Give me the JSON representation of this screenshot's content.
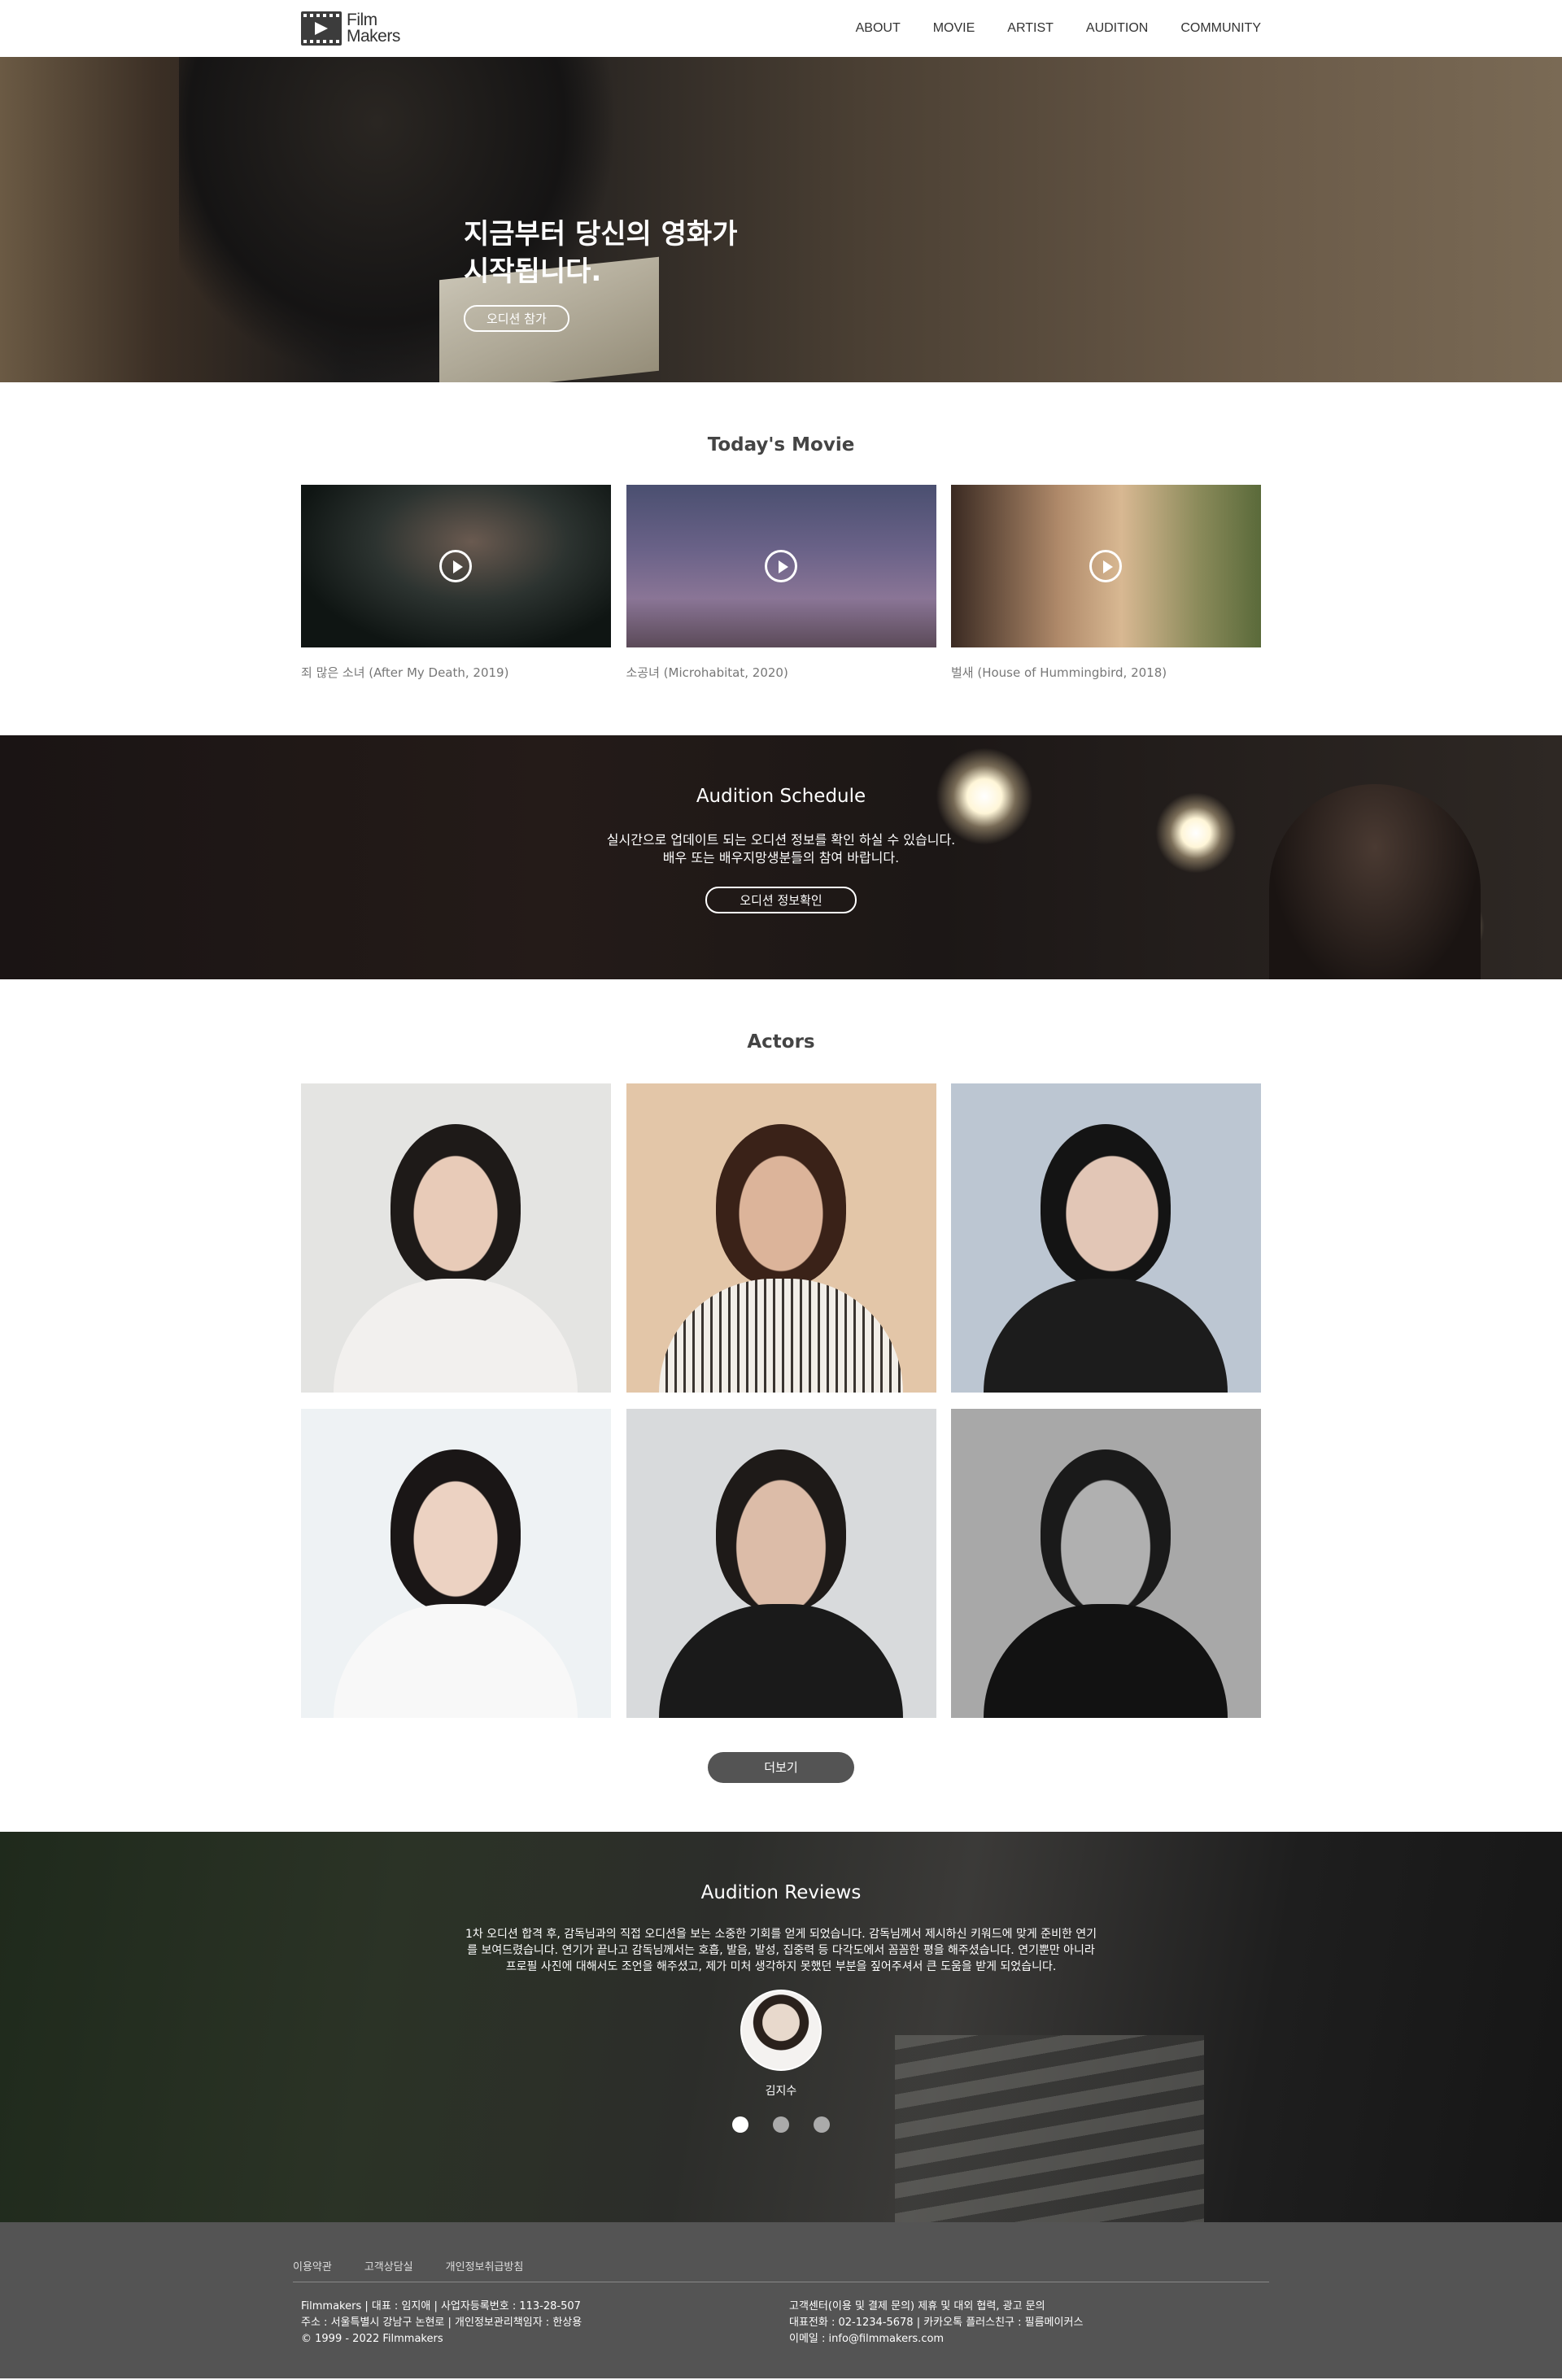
{
  "logo": {
    "line1": "Film",
    "line2": "Makers"
  },
  "nav": {
    "about": "ABOUT",
    "movie": "MOVIE",
    "artist": "ARTIST",
    "audition": "AUDITION",
    "community": "COMMUNITY"
  },
  "hero": {
    "line1": "지금부터 당신의 영화가",
    "line2": "시작됩니다.",
    "button": "오디션 참가"
  },
  "movies": {
    "title": "Today's Movie",
    "items": [
      {
        "caption": "죄 많은 소녀 (After My Death, 2019)"
      },
      {
        "caption": "소공녀 (Microhabitat, 2020)"
      },
      {
        "caption": "벌새 (House of Hummingbird, 2018)"
      }
    ]
  },
  "schedule": {
    "title": "Audition Schedule",
    "line1": "실시간으로 업데이트 되는 오디션 정보를 확인 하실 수 있습니다.",
    "line2": "배우 또는 배우지망생분들의 참여 바랍니다.",
    "button": "오디션 정보확인"
  },
  "actors": {
    "title": "Actors",
    "more": "더보기"
  },
  "reviews": {
    "title": "Audition Reviews",
    "text": "1차 오디션 합격 후, 감독님과의 직접 오디션을 보는 소중한 기회를 얻게 되었습니다. 감독님께서 제시하신 키워드에 맞게 준비한 연기를 보여드렸습니다. 연기가 끝나고 감독님께서는 호흡, 발음, 발성, 집중력 등 다각도에서 꼼꼼한 평을 해주셨습니다. 연기뿐만 아니라 프로필 사진에 대해서도 조언을 해주셨고, 제가 미처 생각하지 못했던 부분을 짚어주셔서 큰 도움을 받게 되었습니다.",
    "name": "김지수"
  },
  "footer": {
    "links": [
      "이용약관",
      "고객상담실",
      "개인정보취급방침"
    ],
    "left": [
      "Filmmakers | 대표 : 임지애 | 사업자등록번호 : 113-28-507",
      "주소 : 서울특별시 강남구 논현로 | 개인정보관리책임자 : 한상용",
      "© 1999 - 2022 Filmmakers"
    ],
    "right": [
      "고객센터(이용 및 결제 문의) 제휴 및 대외 협력, 광고 문의",
      "대표전화 : 02-1234-5678 | 카카오톡 플러스친구 : 필름메이커스",
      "이메일 : info@filmmakers.com"
    ]
  }
}
